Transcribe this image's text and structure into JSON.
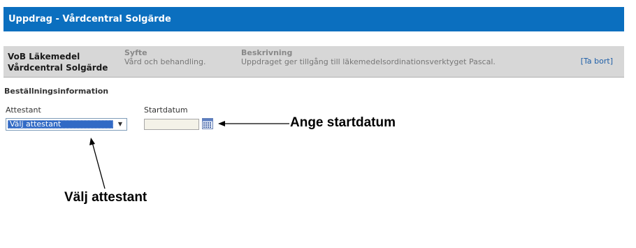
{
  "header": {
    "title": "Uppdrag - Vårdcentral Solgärde"
  },
  "assignment": {
    "name_line1": "VoB Läkemedel",
    "name_line2": "Vårdcentral Solgärde",
    "purpose_label": "Syfte",
    "purpose_value": "Vård och behandling.",
    "description_label": "Beskrivning",
    "description_value": "Uppdraget ger tillgång till läkemedelsordinationsverktyget Pascal.",
    "remove_link": "[Ta bort]"
  },
  "order_info": {
    "section_title": "Beställningsinformation",
    "attestant_label": "Attestant",
    "attestant_selected": "Välj attestant",
    "startdate_label": "Startdatum",
    "startdate_value": ""
  },
  "annotations": {
    "startdate_callout": "Ange startdatum",
    "attestant_callout": "Välj attestant"
  },
  "colors": {
    "header_bg": "#0b6fbf",
    "band_bg": "#d7d7d7",
    "link": "#1f5fa8",
    "selection": "#316ac5"
  },
  "icons": {
    "calendar": "calendar-icon",
    "dropdown": "chevron-down-icon"
  }
}
